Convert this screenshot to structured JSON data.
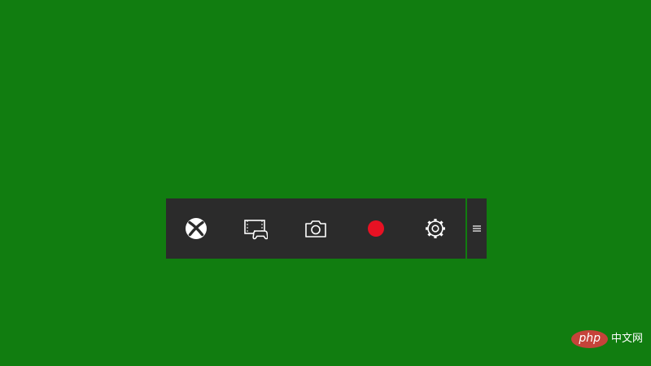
{
  "gamebar": {
    "buttons": [
      {
        "name": "xbox-button",
        "icon": "xbox-logo-icon"
      },
      {
        "name": "broadcast-button",
        "icon": "screen-controller-icon"
      },
      {
        "name": "screenshot-button",
        "icon": "camera-icon"
      },
      {
        "name": "record-button",
        "icon": "record-dot-icon"
      },
      {
        "name": "settings-button",
        "icon": "gear-icon"
      }
    ],
    "handle_icon": "drag-handle-icon"
  },
  "colors": {
    "background": "#117d10",
    "bar": "#2b2b2b",
    "icon": "#ffffff",
    "record": "#e81123"
  },
  "watermark": {
    "logo_text": "php",
    "text": "中文网"
  }
}
